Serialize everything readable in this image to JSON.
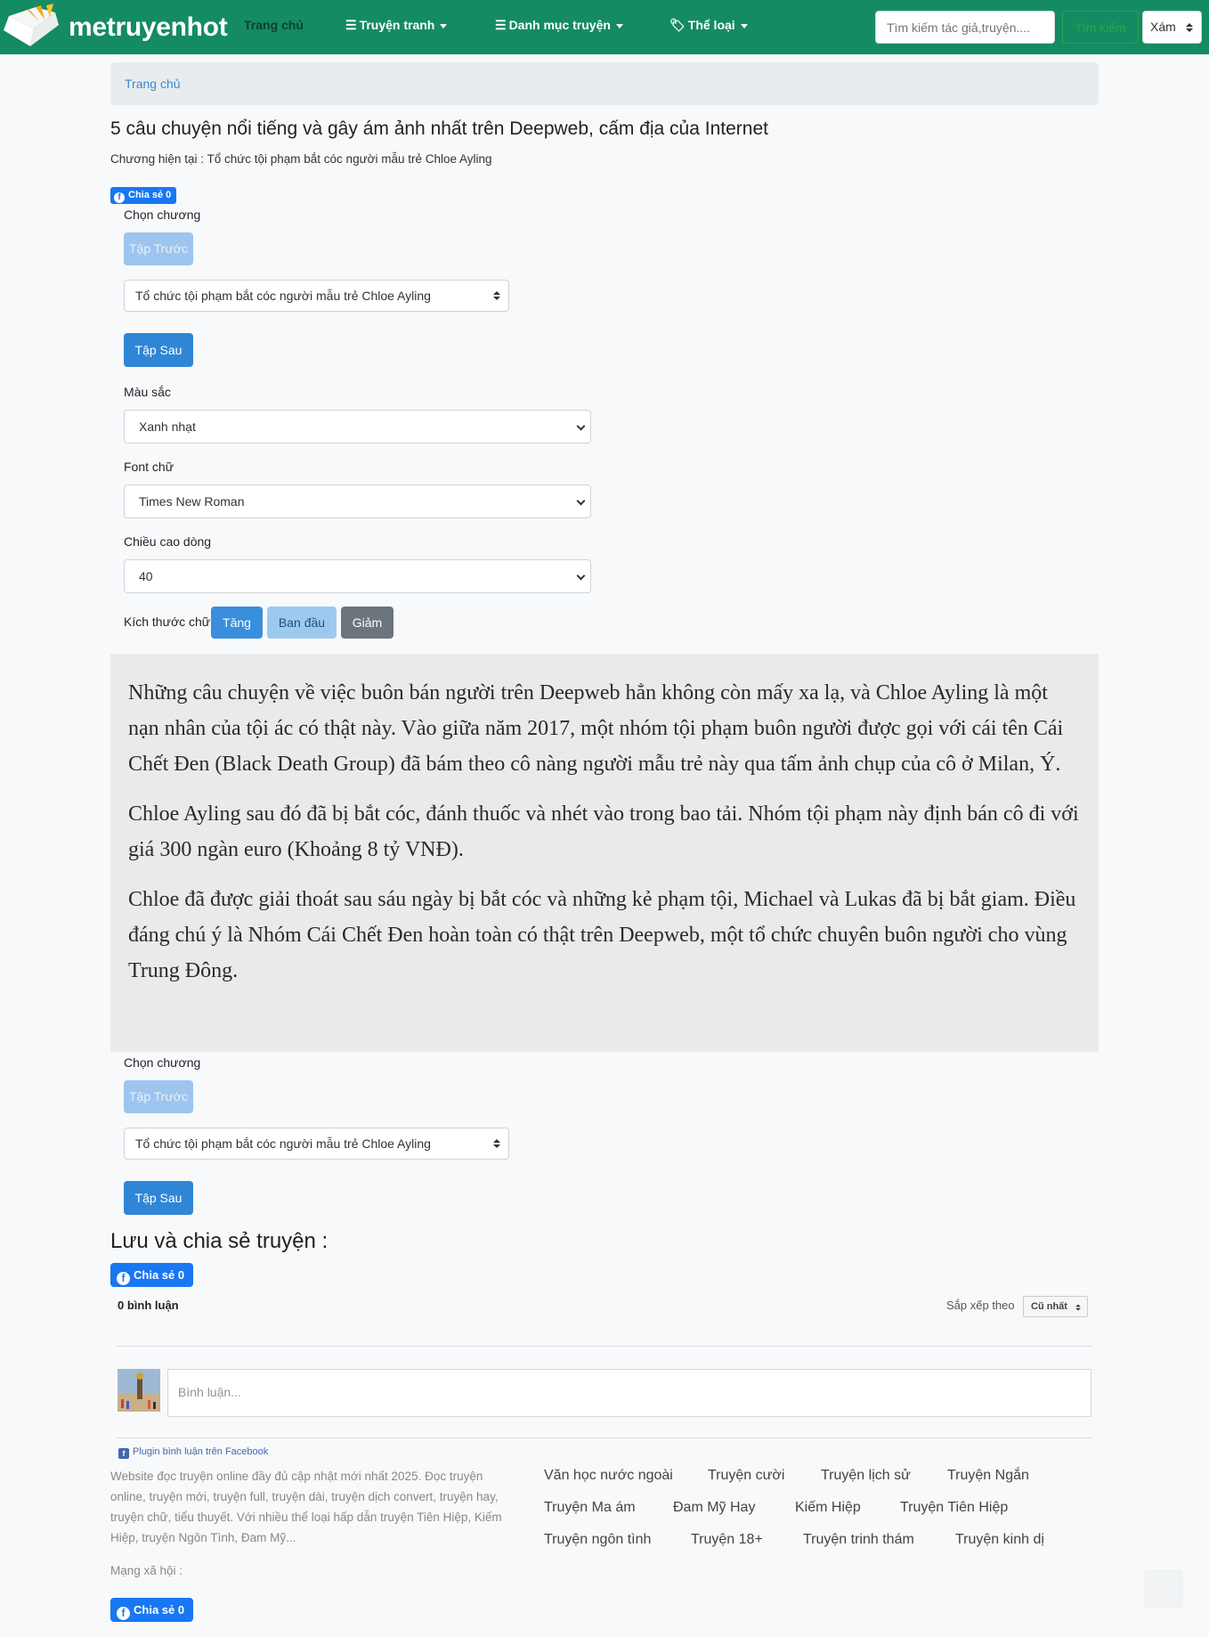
{
  "navbar": {
    "logo_text": "metruyenhot",
    "home": "Trang chủ",
    "menu_comics": "Truyện tranh",
    "menu_categories": "Danh mục truyện",
    "menu_genres": "Thể loại",
    "search_placeholder": "Tìm kiếm tác giả,truyện....",
    "search_button": "Tìm kiếm",
    "theme_value": "Xám",
    "accent_color": "#148b63"
  },
  "breadcrumb": {
    "home": "Trang chủ"
  },
  "story": {
    "title": "5 câu chuyện nổi tiếng và gây ám ảnh nhất trên Deepweb, cấm địa của Internet",
    "current_chapter": "Chương hiện tại : Tổ chức tội phạm bắt cóc người mẫu trẻ Chloe Ayling"
  },
  "share_small": "Chia sẻ 0",
  "chapter_nav": {
    "label": "Chọn chương",
    "prev": "Tập Trước",
    "selected": "Tổ chức tội phạm bắt cóc người mẫu trẻ Chloe Ayling",
    "next": "Tập Sau"
  },
  "settings": {
    "color_label": "Màu sắc",
    "color_value": "Xanh nhạt",
    "font_label": "Font chữ",
    "font_value": "Times New Roman",
    "line_height_label": "Chiều cao dòng",
    "line_height_value": "40",
    "size_label": "Kích thước chữ",
    "size_up": "Tăng",
    "size_default": "Ban đầu",
    "size_down": "Giảm"
  },
  "content": {
    "p1": "Những câu chuyện về việc buôn bán người trên Deepweb hẳn không còn mấy xa lạ, và Chloe Ayling là một nạn nhân của tội ác có thật này. Vào giữa năm 2017, một nhóm tội phạm buôn người được gọi với cái tên Cái Chết Đen (Black Death Group) đã bám theo cô nàng người mẫu trẻ này qua tấm ảnh chụp của cô ở Milan, Ý.",
    "p2": "Chloe Ayling sau đó đã bị bắt cóc, đánh thuốc và nhét vào trong bao tải. Nhóm tội phạm này định bán cô đi với giá 300 ngàn euro (Khoảng 8 tỷ VNĐ).",
    "p3": "Chloe đã được giải thoát sau sáu ngày bị bắt cóc và những kẻ phạm tội, Michael và Lukas đã bị bắt giam. Điều đáng chú ý là Nhóm Cái Chết Đen hoàn toàn có thật trên Deepweb, một tổ chức chuyên buôn người cho vùng Trung Đông."
  },
  "share_section": {
    "title": "Lưu và chia sẻ truyện :",
    "share": "Chia sẻ 0"
  },
  "comments": {
    "count": "0 bình luận",
    "sort_label": "Sắp xếp theo",
    "sort_value": "Cũ nhất",
    "placeholder": "Bình luận...",
    "plugin": "Plugin bình luận trên Facebook"
  },
  "footer": {
    "description": "Website đọc truyện online đầy đủ cập nhật mới nhất 2025. Đọc truyện online, truyện mới, truyện full, truyện dài, truyện dịch convert, truyện hay, truyện chữ, tiểu thuyết. Với nhiều thể loại hấp dẫn truyện Tiên Hiệp, Kiếm Hiệp, truyện Ngôn Tình, Đam Mỹ...",
    "tags": [
      "Văn học nước ngoài",
      "Truyện cười",
      "Truyện lịch sử",
      "Truyện Ngắn",
      "Truyện Ma ám",
      "Đam Mỹ Hay",
      "Kiếm Hiệp",
      "Truyện Tiên Hiệp",
      "Truyện ngôn tình",
      "Truyện 18+",
      "Truyện trinh thám",
      "Truyện kinh dị"
    ],
    "social_label": "Mạng xã hội :",
    "share": "Chia sẻ 0"
  }
}
